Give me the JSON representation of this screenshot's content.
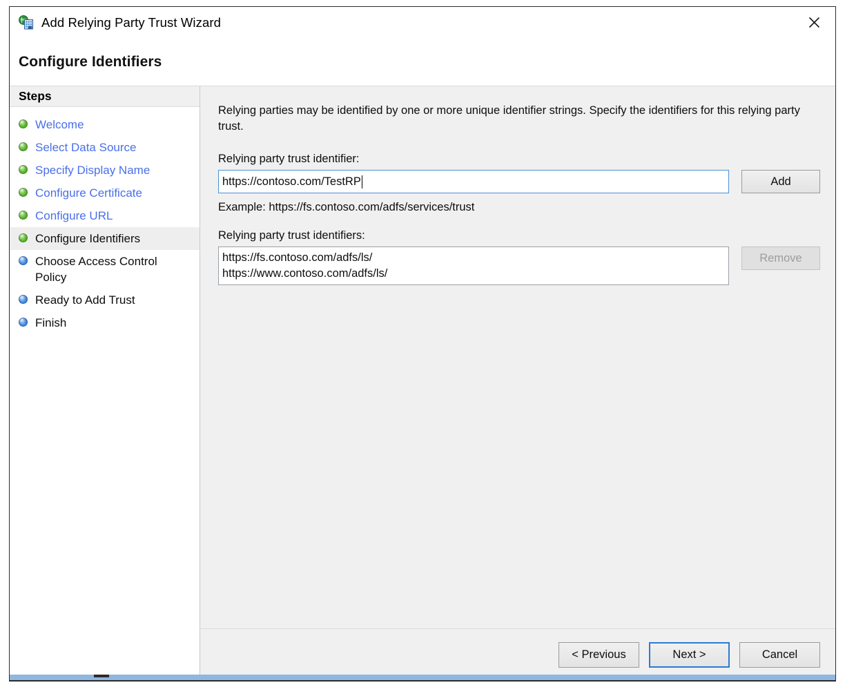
{
  "window": {
    "title": "Add Relying Party Trust Wizard",
    "icon": "adfs-relying-party-icon",
    "close_label": "✕"
  },
  "header": {
    "title": "Configure Identifiers"
  },
  "steps_panel": {
    "header": "Steps",
    "items": [
      {
        "label": "Welcome",
        "state": "done",
        "bullet": "green"
      },
      {
        "label": "Select Data Source",
        "state": "done",
        "bullet": "green"
      },
      {
        "label": "Specify Display Name",
        "state": "done",
        "bullet": "green"
      },
      {
        "label": "Configure Certificate",
        "state": "done",
        "bullet": "green"
      },
      {
        "label": "Configure URL",
        "state": "done",
        "bullet": "green"
      },
      {
        "label": "Configure Identifiers",
        "state": "current",
        "bullet": "green"
      },
      {
        "label": "Choose Access Control Policy",
        "state": "pending",
        "bullet": "blue"
      },
      {
        "label": "Ready to Add Trust",
        "state": "pending",
        "bullet": "blue"
      },
      {
        "label": "Finish",
        "state": "pending",
        "bullet": "blue"
      }
    ]
  },
  "main": {
    "intro": "Relying parties may be identified by one or more unique identifier strings. Specify the identifiers for this relying party trust.",
    "identifier_label": "Relying party trust identifier:",
    "identifier_value": "https://contoso.com/TestRP",
    "add_button": "Add",
    "example": "Example: https://fs.contoso.com/adfs/services/trust",
    "identifiers_label": "Relying party trust identifiers:",
    "identifiers": [
      "https://fs.contoso.com/adfs/ls/",
      "https://www.contoso.com/adfs/ls/"
    ],
    "remove_button": "Remove",
    "remove_enabled": false
  },
  "footer": {
    "previous": "< Previous",
    "next": "Next >",
    "cancel": "Cancel"
  },
  "colors": {
    "link": "#4a6fe8",
    "accent": "#2a7ad2",
    "focus_border": "#4b91d6",
    "bullet_done": "#4aa31f",
    "bullet_pending": "#2f76cf",
    "content_bg": "#f0f0f0"
  }
}
